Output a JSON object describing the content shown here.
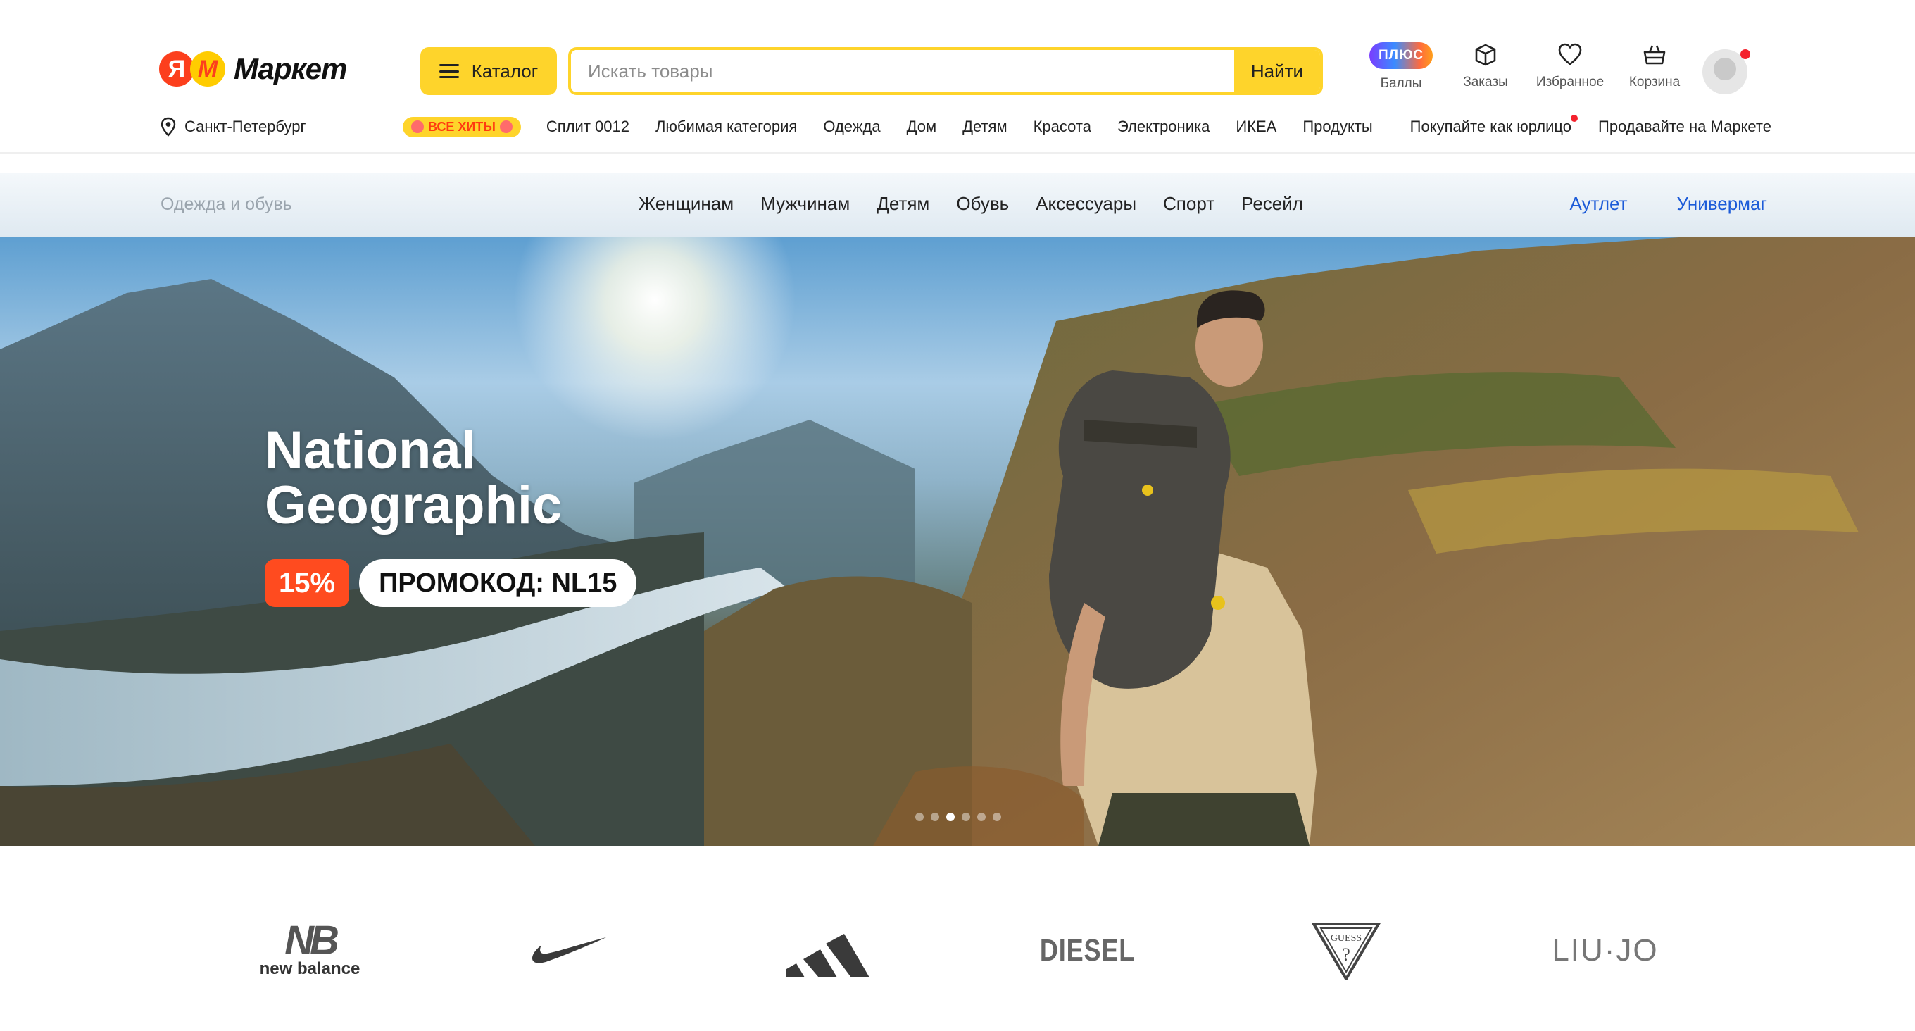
{
  "header": {
    "logo_ya": "Я",
    "logo_m": "M",
    "logo_text": "Маркет",
    "catalog_label": "Каталог",
    "search_placeholder": "Искать товары",
    "search_button": "Найти",
    "plus_badge": "ПЛЮС",
    "icons": [
      {
        "label": "Баллы",
        "icon": "plus-points-icon"
      },
      {
        "label": "Заказы",
        "icon": "box-icon"
      },
      {
        "label": "Избранное",
        "icon": "heart-icon"
      },
      {
        "label": "Корзина",
        "icon": "cart-icon"
      }
    ]
  },
  "subnav": {
    "city": "Санкт-Петербург",
    "hits_badge": "ВСЕ ХИТЫ",
    "links": [
      "Сплит 0012",
      "Любимая категория",
      "Одежда",
      "Дом",
      "Детям",
      "Красота",
      "Электроника",
      "ИКЕА",
      "Продукты"
    ],
    "right_links": [
      "Покупайте как юрлицо",
      "Продавайте на Маркете"
    ]
  },
  "category_bar": {
    "title": "Одежда и обувь",
    "links": [
      "Женщинам",
      "Мужчинам",
      "Детям",
      "Обувь",
      "Аксессуары",
      "Спорт",
      "Ресейл"
    ],
    "right_links": [
      "Аутлет",
      "Универмаг"
    ]
  },
  "hero": {
    "title_line1": "National",
    "title_line2": "Geographic",
    "discount": "15%",
    "promo": "ПРОМОКОД: NL15",
    "slides_count": 6,
    "active_slide": 3
  },
  "brands": {
    "new_balance_mark": "NB",
    "new_balance_text": "new balance",
    "nike": "nike-swoosh-logo",
    "adidas": "adidas-logo",
    "diesel": "DIESEL",
    "guess": "guess-logo",
    "liujo": "LIU·JO"
  },
  "colors": {
    "accent_yellow": "#fed42b",
    "brand_red": "#fc3f1d",
    "link_blue": "#1c5bd8",
    "promo_orange": "#ff4b1f"
  }
}
